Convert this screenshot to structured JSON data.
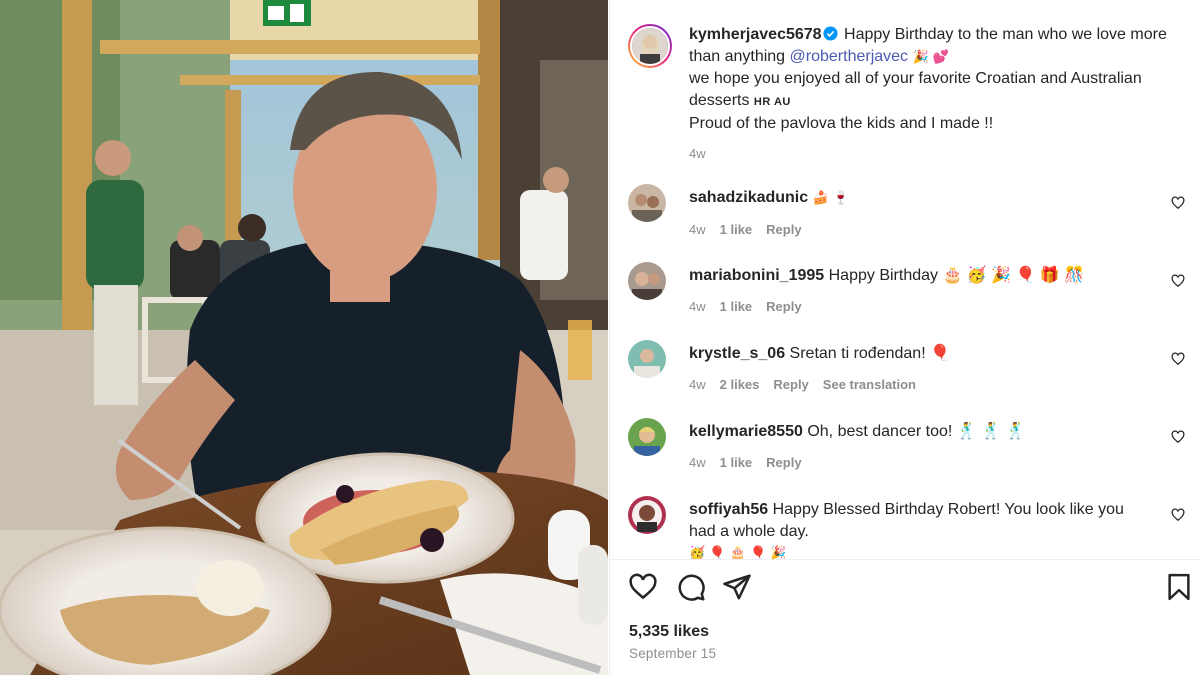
{
  "post": {
    "author": "kymherjavec5678",
    "caption_line1": "Happy Birthday to the man who we love more than anything",
    "mention": "@robertherjavec",
    "caption_emoji1": "🎉 💕",
    "caption_line2": "we hope you enjoyed all of your favorite Croatian and Australian desserts",
    "caption_flags": "HR AU",
    "caption_line3": "Proud of the pavlova the kids and I made !!",
    "time": "4w"
  },
  "comments": [
    {
      "user": "sahadzikadunic",
      "text": "🍰 🍷",
      "time": "4w",
      "likes": "1 like",
      "reply": "Reply",
      "translate": "",
      "avatar_color": "#b48c72"
    },
    {
      "user": "mariabonini_1995",
      "text": "Happy Birthday 🎂 🥳 🎉 🎈 🎁 🎊",
      "time": "4w",
      "likes": "1 like",
      "reply": "Reply",
      "translate": "",
      "avatar_color": "#6d5d54"
    },
    {
      "user": "krystle_s_06",
      "text": "Sretan ti rođendan! 🎈",
      "time": "4w",
      "likes": "2 likes",
      "reply": "Reply",
      "translate": "See translation",
      "avatar_color": "#5c9a8a"
    },
    {
      "user": "kellymarie8550",
      "text": "Oh, best dancer too! 🕺 🕺 🕺",
      "time": "4w",
      "likes": "1 like",
      "reply": "Reply",
      "translate": "",
      "avatar_color": "#4f8b3a"
    },
    {
      "user": "soffiyah56",
      "text": "Happy Blessed Birthday Robert! You look like you had a whole day.",
      "emoji_line": "🥳 🎈 🎂 🎈 🎉",
      "avatar_color": "#7a2d3a"
    }
  ],
  "actions": {
    "like_icon": "heart-icon",
    "comment_icon": "comment-icon",
    "share_icon": "share-icon",
    "save_icon": "bookmark-icon"
  },
  "likes_count": "5,335 likes",
  "date": "September 15",
  "photo": {
    "exit_sign_icon": "exit-sign-icon"
  },
  "colors": {
    "mention": "#4b5ab3",
    "muted": "#8e8e8e",
    "verified": "#0095f6"
  }
}
